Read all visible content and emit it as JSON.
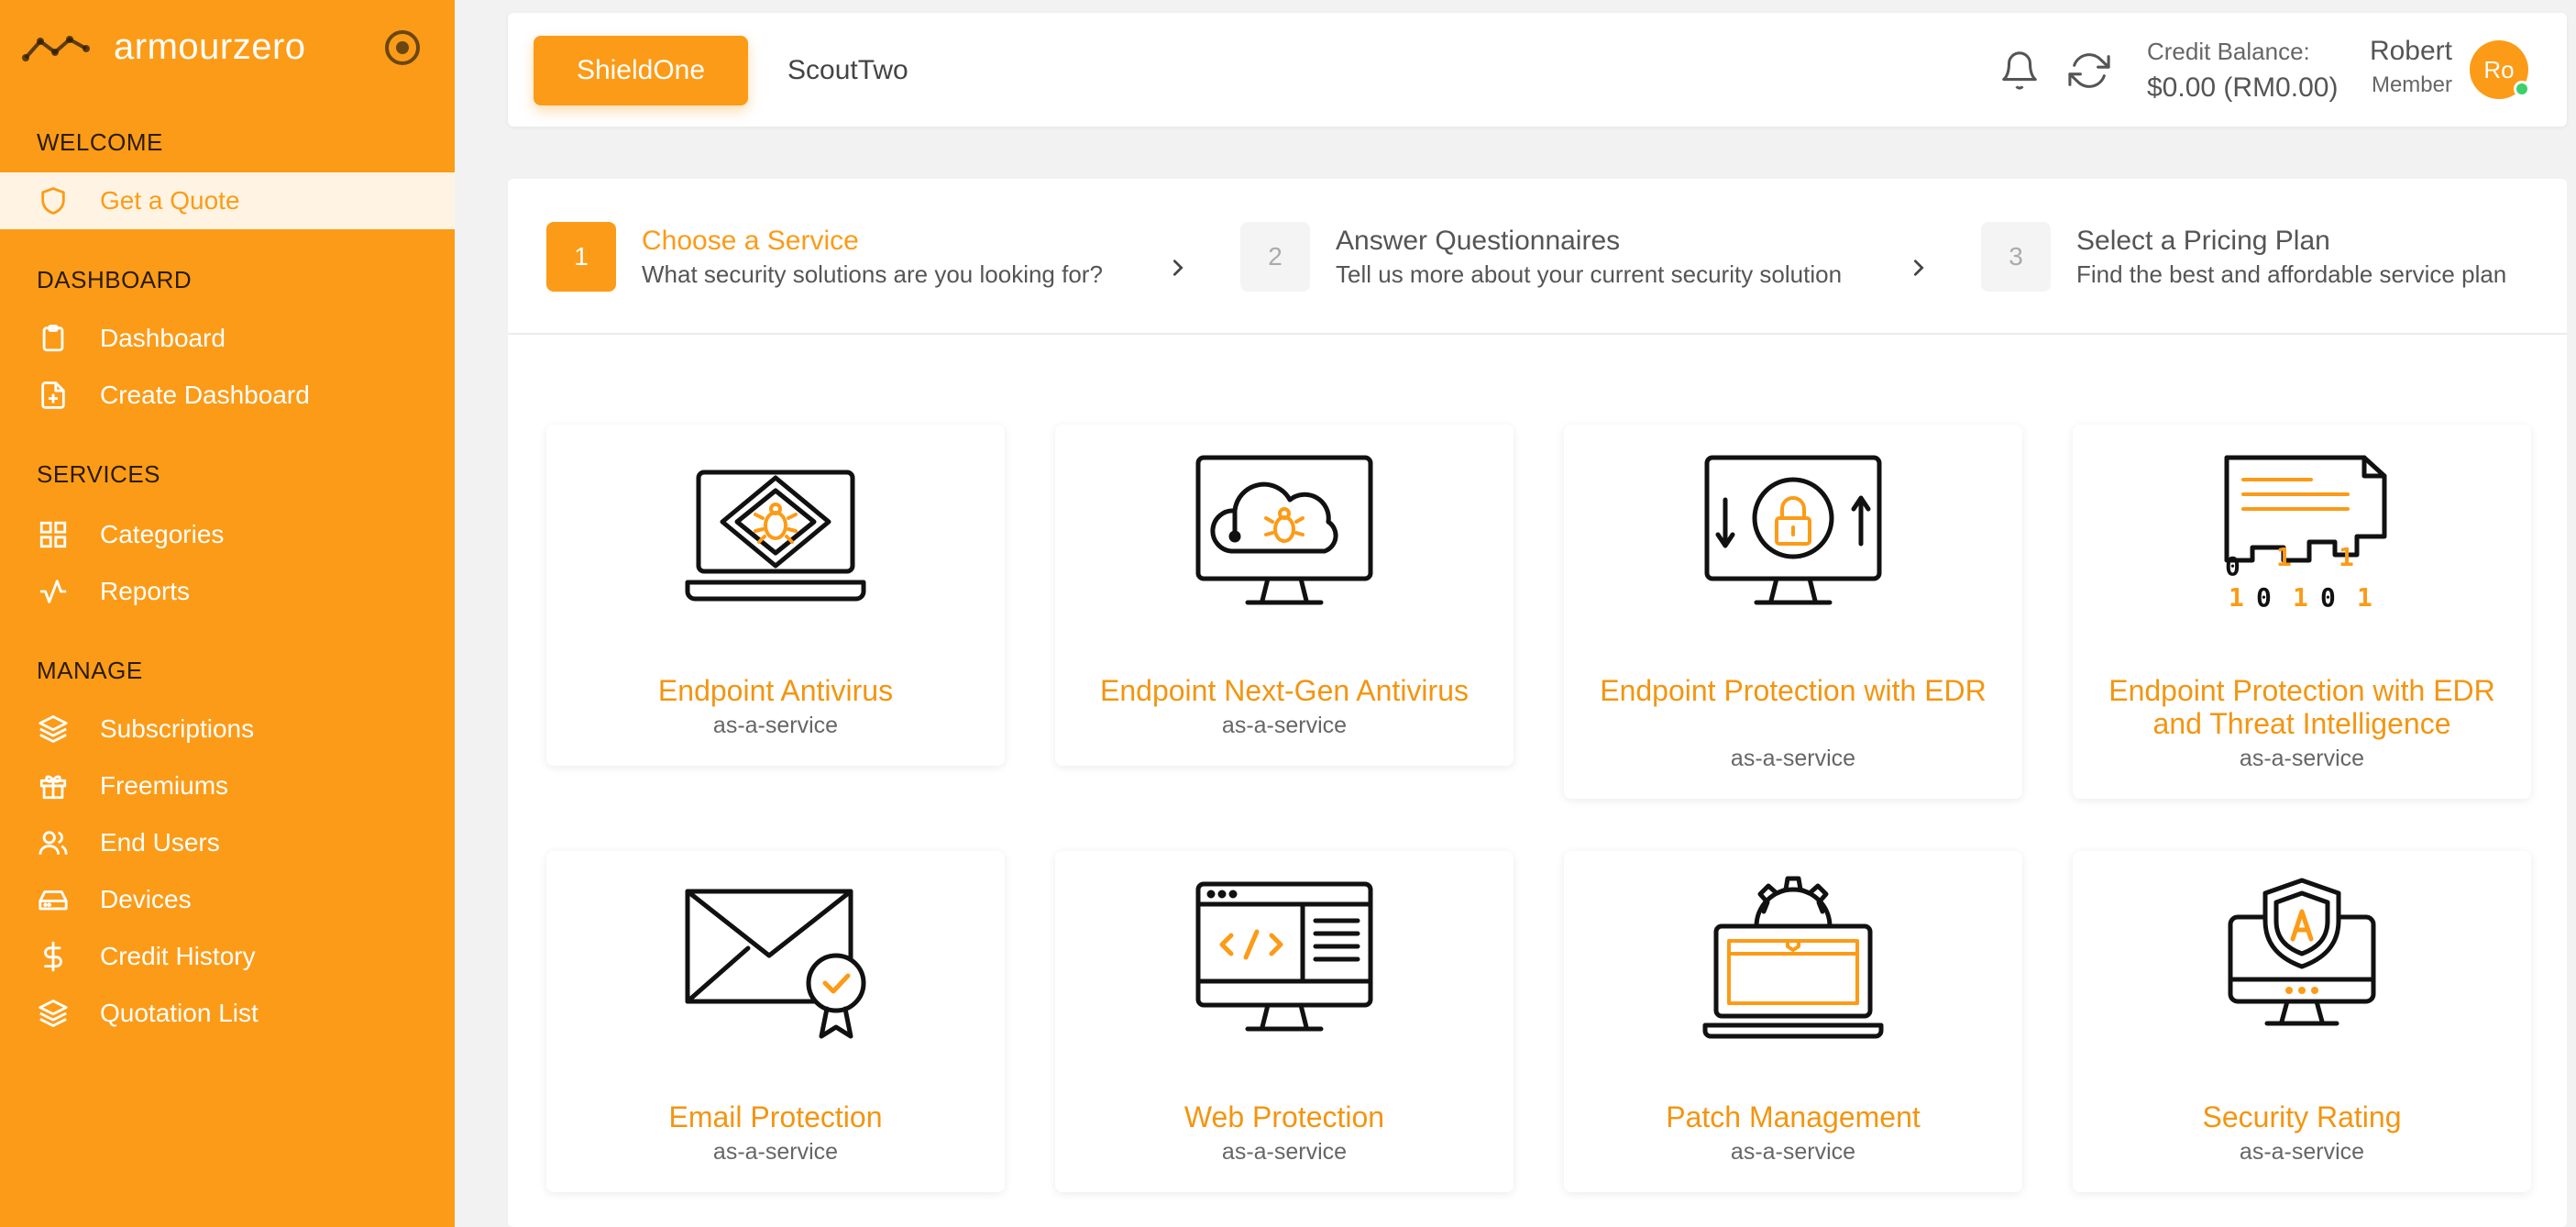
{
  "brand": {
    "name": "armourzero"
  },
  "sidebar": {
    "sections": [
      "WELCOME",
      "DASHBOARD",
      "SERVICES",
      "MANAGE"
    ],
    "items": [
      {
        "label": "Get a Quote",
        "icon": "shield-icon"
      },
      {
        "label": "Dashboard",
        "icon": "clipboard-icon"
      },
      {
        "label": "Create Dashboard",
        "icon": "file-plus-icon"
      },
      {
        "label": "Categories",
        "icon": "grid-icon"
      },
      {
        "label": "Reports",
        "icon": "activity-icon"
      },
      {
        "label": "Subscriptions",
        "icon": "layers-icon"
      },
      {
        "label": "Freemiums",
        "icon": "gift-icon"
      },
      {
        "label": "End Users",
        "icon": "users-icon"
      },
      {
        "label": "Devices",
        "icon": "hard-drive-icon"
      },
      {
        "label": "Credit History",
        "icon": "dollar-icon"
      },
      {
        "label": "Quotation List",
        "icon": "layers-icon"
      }
    ]
  },
  "topbar": {
    "tabs": [
      "ShieldOne",
      "ScoutTwo"
    ],
    "credit_label": "Credit Balance:",
    "credit_amount": "$0.00 (RM0.00)",
    "user_name": "Robert",
    "user_role": "Member",
    "avatar_initials": "Ro"
  },
  "steps": [
    {
      "num": "1",
      "title": "Choose a Service",
      "subtitle": "What security solutions are you looking for?"
    },
    {
      "num": "2",
      "title": "Answer Questionnaires",
      "subtitle": "Tell us more about your current security solution"
    },
    {
      "num": "3",
      "title": "Select a Pricing Plan",
      "subtitle": "Find the best and affordable service plan"
    }
  ],
  "services": [
    {
      "title": "Endpoint Antivirus",
      "subtitle": "as-a-service"
    },
    {
      "title": "Endpoint Next-Gen Antivirus",
      "subtitle": "as-a-service"
    },
    {
      "title": "Endpoint Protection with EDR",
      "subtitle": "as-a-service"
    },
    {
      "title": "Endpoint Protection with EDR and Threat Intelligence",
      "subtitle": "as-a-service"
    },
    {
      "title": "Email Protection",
      "subtitle": "as-a-service"
    },
    {
      "title": "Web Protection",
      "subtitle": "as-a-service"
    },
    {
      "title": "Patch Management",
      "subtitle": "as-a-service"
    },
    {
      "title": "Security Rating",
      "subtitle": "as-a-service"
    }
  ],
  "colors": {
    "accent": "#fc9b17",
    "accent_light": "#fff4e3",
    "status_online": "#3ccf6b"
  }
}
